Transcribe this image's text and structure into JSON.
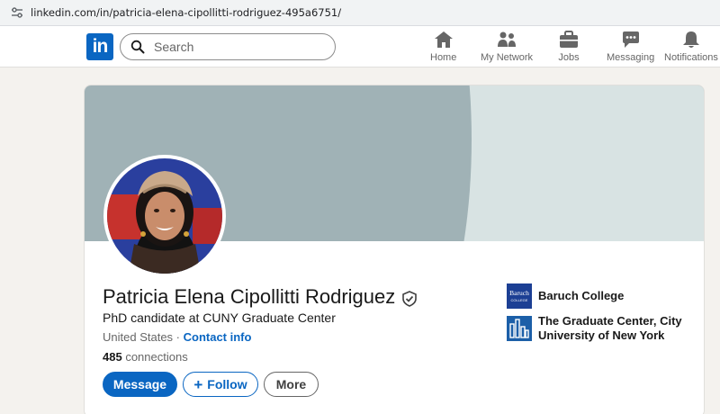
{
  "browser": {
    "url": "linkedin.com/in/patricia-elena-cipollitti-rodriguez-495a6751/"
  },
  "nav": {
    "logo_text": "in",
    "search_placeholder": "Search",
    "items": [
      {
        "label": "Home",
        "icon": "home-icon"
      },
      {
        "label": "My Network",
        "icon": "network-icon"
      },
      {
        "label": "Jobs",
        "icon": "briefcase-icon"
      },
      {
        "label": "Messaging",
        "icon": "chat-icon"
      },
      {
        "label": "Notifications",
        "icon": "bell-icon"
      }
    ]
  },
  "profile": {
    "name": "Patricia Elena Cipollitti Rodriguez",
    "headline": "PhD candidate at CUNY Graduate Center",
    "location": "United States",
    "separator": " · ",
    "contact_info": "Contact info",
    "connections_count": "485",
    "connections_label": " connections",
    "buttons": {
      "message": "Message",
      "follow": "Follow",
      "more": "More"
    }
  },
  "organizations": [
    {
      "name": "Baruch College",
      "logo_text": "Baruch COLLEGE"
    },
    {
      "name_line1": "The Graduate Center, City",
      "name_line2": "University of New York"
    }
  ],
  "colors": {
    "brand": "#0a66c2",
    "banner": "#a0b2b6",
    "page_bg": "#f4f2ee"
  }
}
